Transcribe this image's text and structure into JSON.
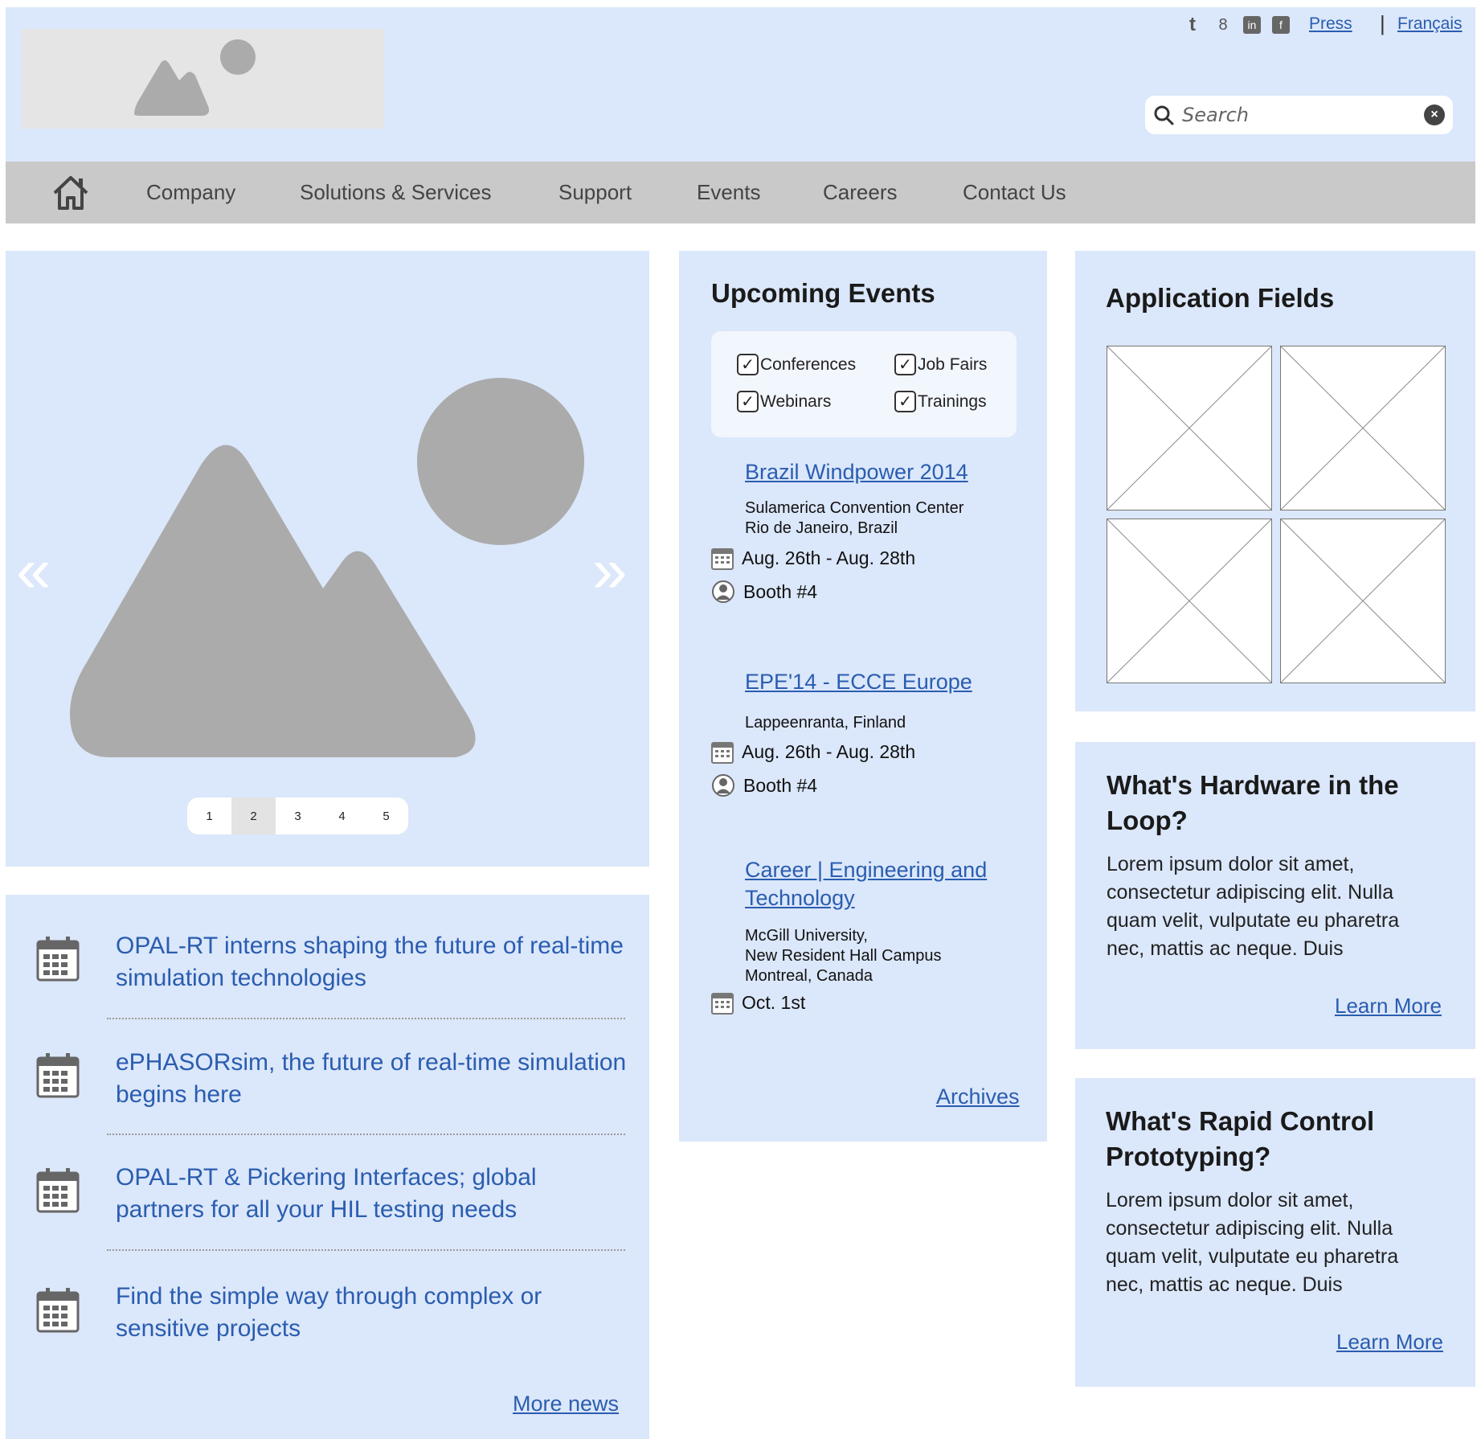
{
  "header": {
    "top_links": {
      "press": "Press",
      "separator": "|",
      "language": "Français"
    },
    "social_icons": [
      "twitter-icon",
      "google-plus-icon",
      "linkedin-icon",
      "facebook-icon"
    ],
    "search": {
      "placeholder": "Search"
    }
  },
  "nav": {
    "items": [
      {
        "label": "Company"
      },
      {
        "label": "Solutions & Services"
      },
      {
        "label": "Support"
      },
      {
        "label": "Events"
      },
      {
        "label": "Careers"
      },
      {
        "label": "Contact Us"
      }
    ]
  },
  "slider": {
    "prev": "«",
    "next": "»",
    "pages": [
      "1",
      "2",
      "3",
      "4",
      "5"
    ],
    "active_page": 2
  },
  "news": {
    "items": [
      {
        "title": "OPAL-RT interns shaping the future of real-time simulation technologies"
      },
      {
        "title": "ePHASORsim, the future of real-time simulation begins here"
      },
      {
        "title": "OPAL-RT & Pickering Interfaces; global partners for all your HIL testing needs"
      },
      {
        "title": "Find the simple way through complex or sensitive projects"
      }
    ],
    "more": "More news"
  },
  "events": {
    "title": "Upcoming Events",
    "filters": [
      {
        "label": "Conferences",
        "checked": true
      },
      {
        "label": "Job Fairs",
        "checked": true
      },
      {
        "label": "Webinars",
        "checked": true
      },
      {
        "label": "Trainings",
        "checked": true
      }
    ],
    "list": [
      {
        "name": "Brazil Windpower 2014",
        "location_lines": [
          "Sulamerica Convention Center",
          "Rio de Janeiro, Brazil"
        ],
        "dates": "Aug. 26th - Aug. 28th",
        "booth": "Booth #4"
      },
      {
        "name": "EPE'14 - ECCE Europe",
        "location_lines": [
          "Lappeenranta, Finland"
        ],
        "dates": "Aug. 26th - Aug. 28th",
        "booth": "Booth #4"
      },
      {
        "name_lines": [
          "Career | Engineering and",
          "Technology"
        ],
        "location_lines": [
          "McGill University,",
          "New Resident Hall Campus",
          "Montreal, Canada"
        ],
        "dates": "Oct. 1st"
      }
    ],
    "archives": "Archives"
  },
  "apps": {
    "title": "Application Fields"
  },
  "hil": {
    "title_lines": [
      "What's Hardware in the",
      "Loop?"
    ],
    "body_lines": [
      "Lorem ipsum dolor sit amet,",
      "consectetur adipiscing elit. Nulla",
      "quam velit, vulputate eu pharetra",
      "nec, mattis ac neque. Duis"
    ],
    "learn_more": "Learn More"
  },
  "rcp": {
    "title_lines": [
      "What's Rapid Control",
      "Prototyping?"
    ],
    "body_lines": [
      "Lorem ipsum dolor sit amet,",
      "consectetur adipiscing elit. Nulla",
      "quam velit, vulputate eu pharetra",
      "nec, mattis ac neque. Duis"
    ],
    "learn_more": "Learn More"
  },
  "colors": {
    "panel_bg": "#dbe7fa",
    "nav_bg": "#c9c9c9",
    "link": "#2a5db0",
    "placeholder_gray": "#ababab"
  }
}
